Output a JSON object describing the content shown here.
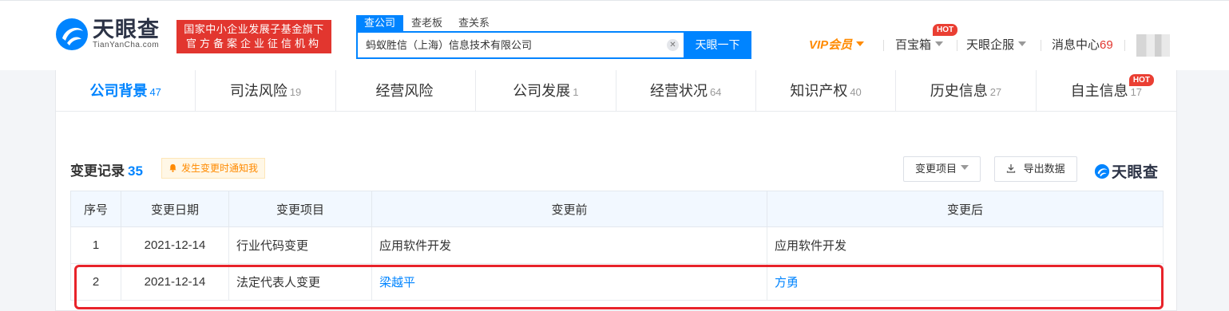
{
  "header": {
    "logo_title": "天眼查",
    "logo_sub": "TianYanCha.com",
    "badge_line1": "国家中小企业发展子基金旗下",
    "badge_line2": "官方备案企业征信机构",
    "search_tabs": [
      "查公司",
      "查老板",
      "查关系"
    ],
    "search_value": "蚂蚁胜信（上海）信息技术有限公司",
    "search_button": "天眼一下",
    "nav": {
      "vip": "VIP会员",
      "toolbox": "百宝箱",
      "toolbox_badge": "HOT",
      "enterprise": "天眼企服",
      "messages": "消息中心",
      "message_count": "69"
    }
  },
  "tabs": [
    {
      "label": "公司背景",
      "count": "47"
    },
    {
      "label": "司法风险",
      "count": "19"
    },
    {
      "label": "经营风险",
      "count": ""
    },
    {
      "label": "公司发展",
      "count": "1"
    },
    {
      "label": "经营状况",
      "count": "64"
    },
    {
      "label": "知识产权",
      "count": "40"
    },
    {
      "label": "历史信息",
      "count": "27"
    },
    {
      "label": "自主信息",
      "count": "17",
      "badge": "HOT"
    }
  ],
  "section": {
    "title": "变更记录",
    "count": "35",
    "notify": "发生变更时通知我",
    "filter": "变更项目",
    "export": "导出数据",
    "brand": "天眼查"
  },
  "table": {
    "headers": [
      "序号",
      "变更日期",
      "变更项目",
      "变更前",
      "变更后"
    ],
    "rows": [
      {
        "no": "1",
        "date": "2021-12-14",
        "item": "行业代码变更",
        "before": "应用软件开发",
        "after": "应用软件开发"
      },
      {
        "no": "2",
        "date": "2021-12-14",
        "item": "法定代表人变更",
        "before": "梁越平",
        "after": "方勇"
      }
    ]
  },
  "colors": {
    "accent": "#0084ff",
    "brand_red": "#e2362f",
    "vip_orange": "#ff8a00",
    "highlight": "#e8232a"
  }
}
